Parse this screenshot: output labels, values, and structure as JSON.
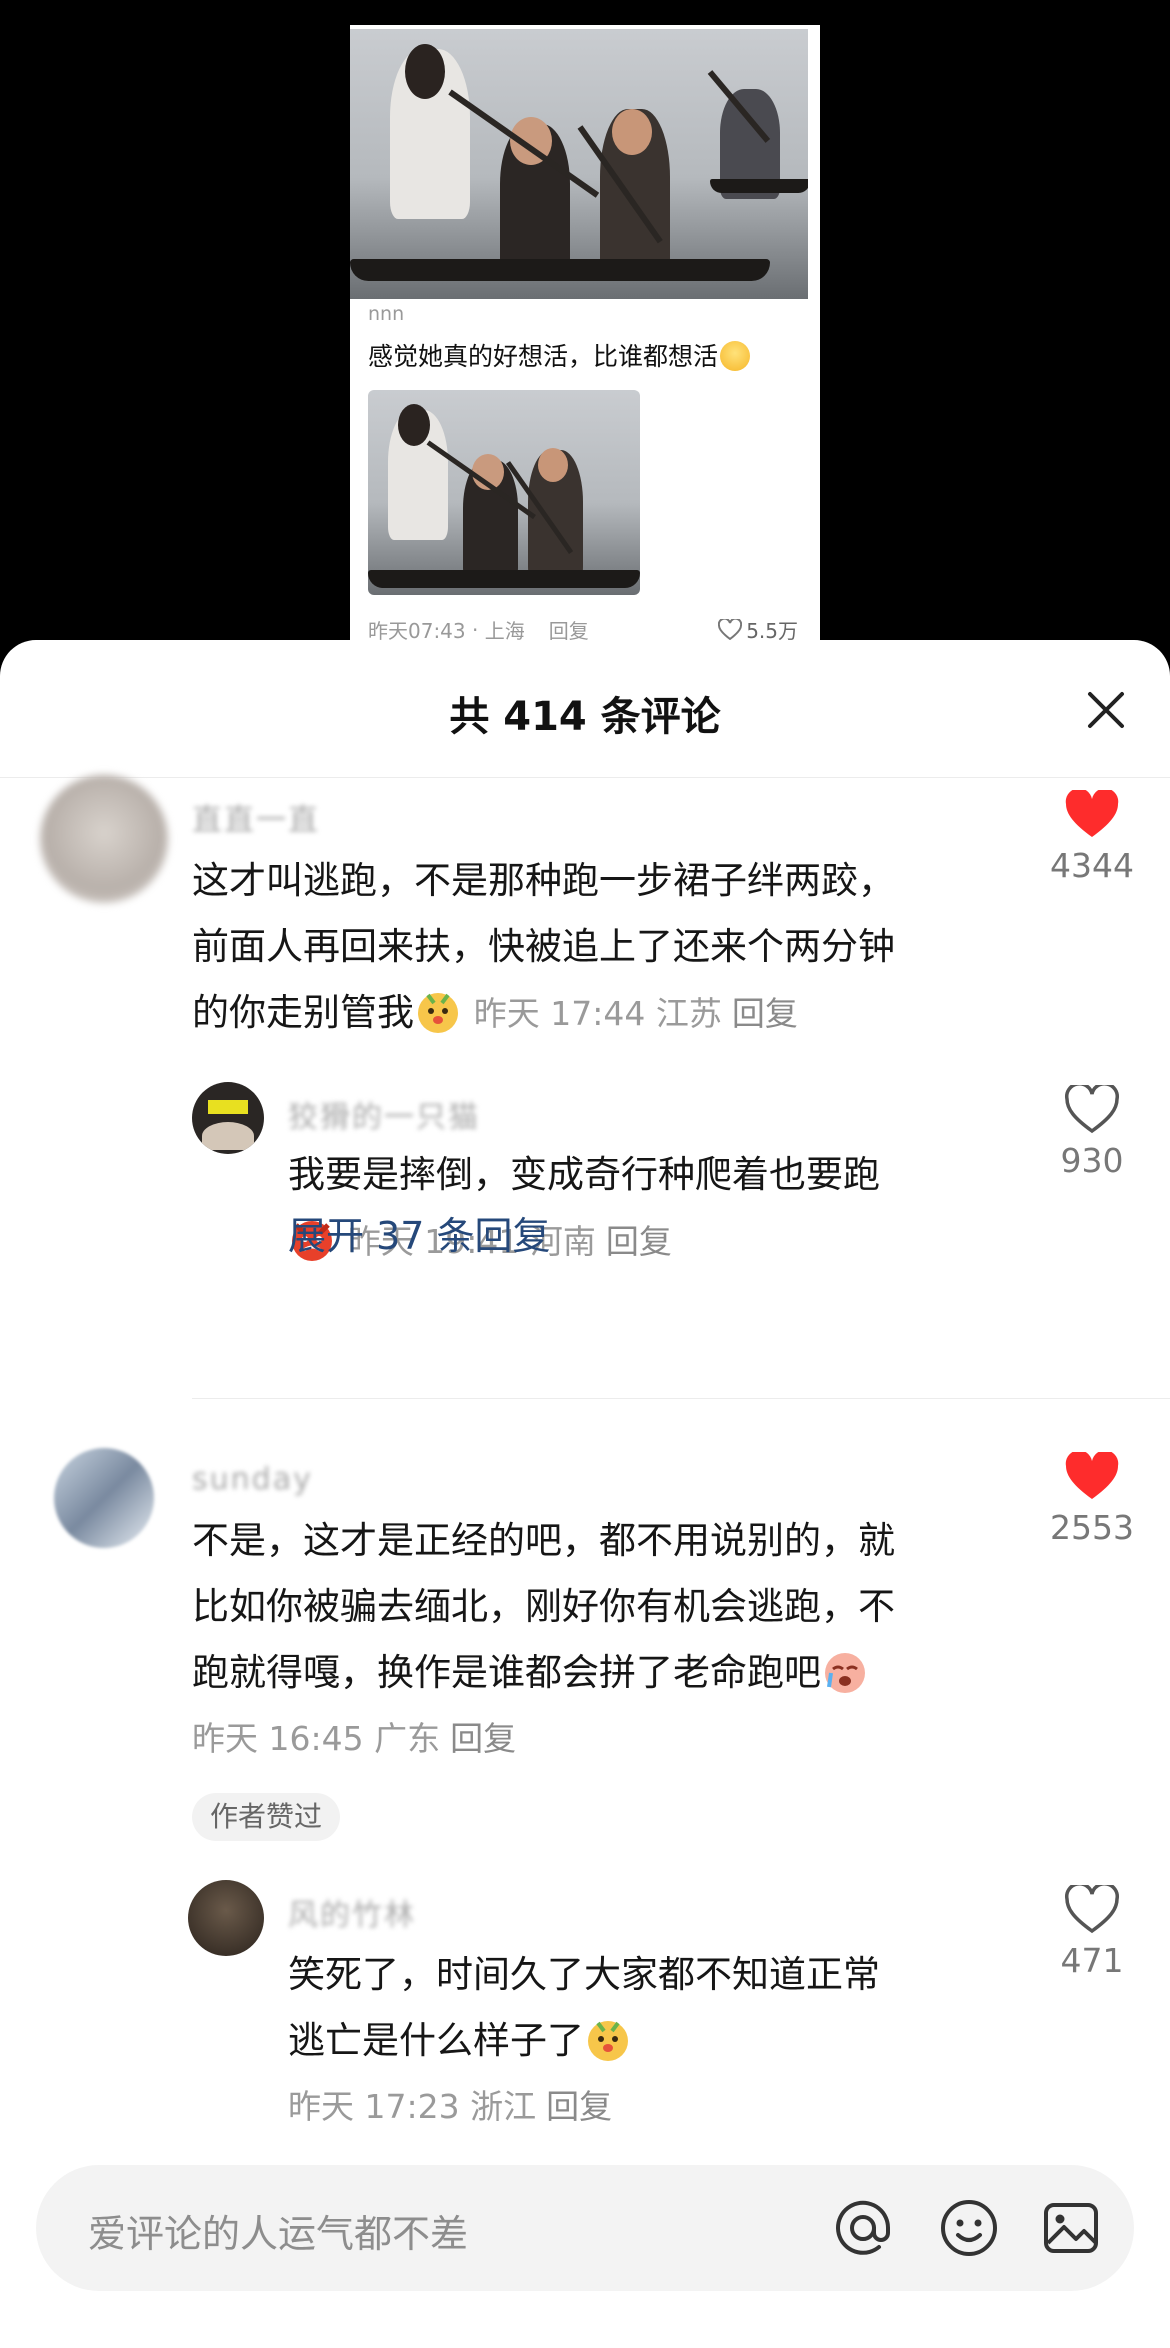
{
  "preview": {
    "reply_user": "nnn",
    "reply_text": "感觉她真的好想活，比谁都想活",
    "time": "昨天07:43",
    "location": "上海",
    "reply_label": "回复",
    "likes": "5.5万"
  },
  "sheet": {
    "title": "共 414 条评论",
    "close_icon": "close-icon"
  },
  "comments": [
    {
      "user": "直直一直",
      "text_lines": [
        "这才叫逃跑，不是那种跑一步裙子绊两跤，",
        "前面人再回来扶，快被追上了还来个两分钟",
        "的你走别管我"
      ],
      "time": "昨天 17:44",
      "location": "江苏",
      "reply_label": "回复",
      "likes": "4344",
      "liked": true,
      "like_color": "#fe2c2c"
    },
    {
      "user": "狡猾的一只猫",
      "text_lines": [
        "我要是摔倒，变成奇行种爬着也要跑"
      ],
      "time": "昨天 19:41",
      "location": "河南",
      "reply_label": "回复",
      "likes": "930",
      "liked": false
    },
    {
      "user": "sunday",
      "text_lines": [
        "不是，这才是正经的吧，都不用说别的，就",
        "比如你被骗去缅北，刚好你有机会逃跑，不",
        "跑就得嘎，换作是谁都会拼了老命跑吧"
      ],
      "time": "昨天 16:45",
      "location": "广东",
      "reply_label": "回复",
      "badge": "作者赞过",
      "likes": "2553",
      "liked": true,
      "like_color": "#fe2c2c"
    },
    {
      "user": "风的竹林",
      "text_lines": [
        "笑死了，时间久了大家都不知道正常",
        "逃亡是什么样子了"
      ],
      "time": "昨天 17:23",
      "location": "浙江",
      "reply_label": "回复",
      "likes": "471",
      "liked": false
    }
  ],
  "expand_replies": "展开 37 条回复",
  "input": {
    "placeholder": "爱评论的人运气都不差",
    "icons": [
      "at-icon",
      "emoji-icon",
      "image-icon"
    ]
  }
}
